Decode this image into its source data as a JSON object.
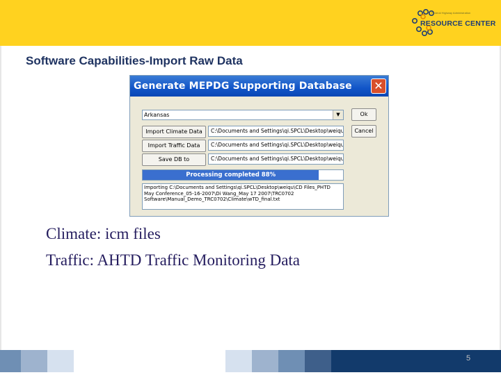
{
  "logo": {
    "small_text": "Federal Highway Administration",
    "main_text": "RESOURCE CENTER"
  },
  "slide": {
    "title": "Software Capabilities-Import Raw Data",
    "bullets": [
      "Climate: icm files",
      "Traffic: AHTD Traffic Monitoring Data"
    ],
    "page_number": "5"
  },
  "dialog": {
    "title": "Generate MEPDG Supporting Database",
    "close_glyph": "✕",
    "state_select": {
      "value": "Arkansas",
      "arrow": "▼"
    },
    "ok_label": "Ok",
    "cancel_label": "Cancel",
    "import_climate_label": "Import Climate Data",
    "import_traffic_label": "Import Traffic Data",
    "save_db_label": "Save DB to",
    "climate_path": "C:\\Documents and Settings\\qi.SPCL\\Desktop\\weiqu",
    "traffic_path": "C:\\Documents and Settings\\qi.SPCL\\Desktop\\weiqu",
    "save_path": "C:\\Documents and Settings\\qi.SPCL\\Desktop\\weiqu",
    "progress": {
      "text": "Processing completed 88%",
      "percent": 88
    },
    "log_lines": [
      "Importing C:\\Documents and Settings\\qi.SPCL\\Desktop\\weiqu\\CD Files_PHTD",
      "May Conference_05-16-2007\\Di Wang_May 17 2007\\TRC0702",
      "Software\\Manual_Demo_TRC0702\\Climate\\wTD_final.txt"
    ]
  },
  "colors": {
    "banner": "#ffd21f",
    "title_text": "#1f3361",
    "bullet_text": "#241c5e",
    "xp_titlebar": "#1155c8",
    "progress_fill": "#3a6fcf"
  }
}
